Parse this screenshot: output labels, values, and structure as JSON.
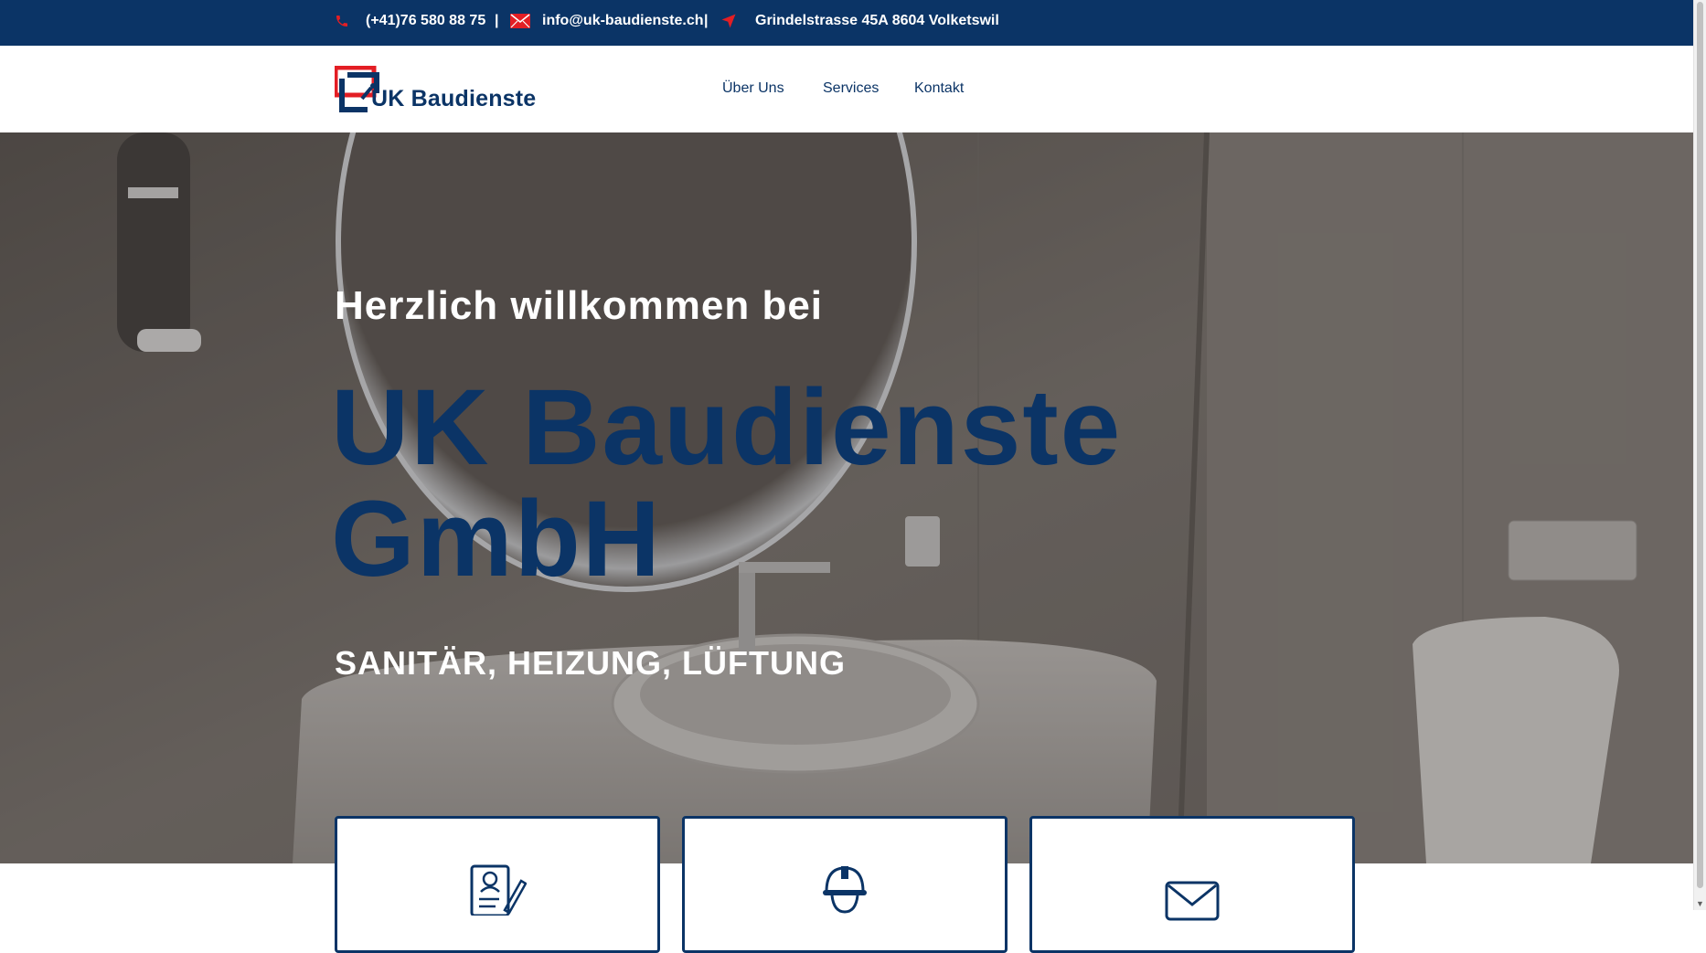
{
  "colors": {
    "navy": "#0b3466",
    "red": "#e31e24",
    "white": "#ffffff"
  },
  "topbar": {
    "phone": {
      "icon": "phone-icon",
      "text": "(+41)76 580 88 75"
    },
    "email": {
      "icon": "mail-icon",
      "text": "info@uk-baudienste.ch"
    },
    "address": {
      "icon": "location-arrow-icon",
      "text": "Grindelstrasse 45A 8604 Volketswil"
    },
    "separator": "|"
  },
  "header": {
    "logo_text": "UK Baudienste",
    "nav": [
      {
        "label": "Über Uns"
      },
      {
        "label": "Services"
      },
      {
        "label": "Kontakt"
      }
    ]
  },
  "hero": {
    "welcome": "Herzlich willkommen bei",
    "brand": "UK Baudienste GmbH",
    "subtitle": "SANITÄR, HEIZUNG, LÜFTUNG"
  },
  "cards": [
    {
      "icon": "document-edit-icon"
    },
    {
      "icon": "worker-helmet-icon"
    },
    {
      "icon": "envelope-icon"
    }
  ]
}
